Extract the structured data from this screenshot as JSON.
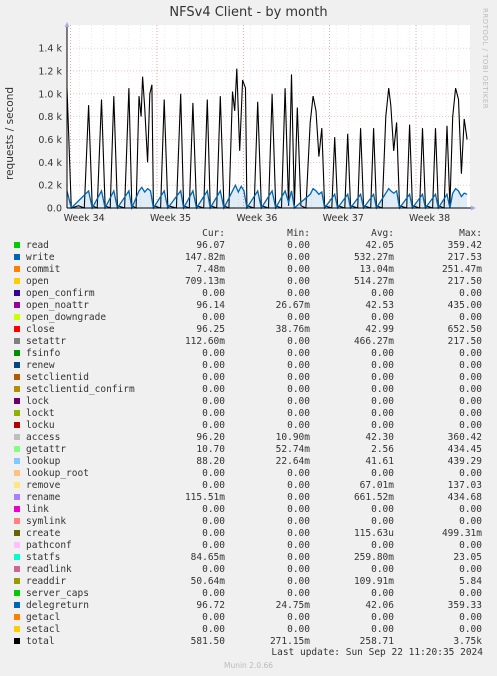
{
  "title": "NFSv4 Client - by month",
  "side_text": "RRDTOOL / TOBI OETIKER",
  "ylabel": "requests / second",
  "columns": {
    "cur": "Cur:",
    "min": "Min:",
    "avg": "Avg:",
    "max": "Max:"
  },
  "legend": [
    {
      "name": "read",
      "color": "#00cc00",
      "cur": "96.07",
      "min": "0.00",
      "avg": "42.05",
      "max": "359.42"
    },
    {
      "name": "write",
      "color": "#0066b3",
      "cur": "147.82m",
      "min": "0.00",
      "avg": "532.27m",
      "max": "217.53"
    },
    {
      "name": "commit",
      "color": "#ff8000",
      "cur": "7.48m",
      "min": "0.00",
      "avg": "13.04m",
      "max": "251.47m"
    },
    {
      "name": "open",
      "color": "#ffcc00",
      "cur": "709.13m",
      "min": "0.00",
      "avg": "514.27m",
      "max": "217.50"
    },
    {
      "name": "open_confirm",
      "color": "#330099",
      "cur": "0.00",
      "min": "0.00",
      "avg": "0.00",
      "max": "0.00"
    },
    {
      "name": "open_noattr",
      "color": "#990099",
      "cur": "96.14",
      "min": "26.67m",
      "avg": "42.53",
      "max": "435.00"
    },
    {
      "name": "open_downgrade",
      "color": "#ccff00",
      "cur": "0.00",
      "min": "0.00",
      "avg": "0.00",
      "max": "0.00"
    },
    {
      "name": "close",
      "color": "#ff0000",
      "cur": "96.25",
      "min": "38.76m",
      "avg": "42.99",
      "max": "652.50"
    },
    {
      "name": "setattr",
      "color": "#808080",
      "cur": "112.60m",
      "min": "0.00",
      "avg": "466.27m",
      "max": "217.50"
    },
    {
      "name": "fsinfo",
      "color": "#008f00",
      "cur": "0.00",
      "min": "0.00",
      "avg": "0.00",
      "max": "0.00"
    },
    {
      "name": "renew",
      "color": "#00487d",
      "cur": "0.00",
      "min": "0.00",
      "avg": "0.00",
      "max": "0.00"
    },
    {
      "name": "setclientid",
      "color": "#b35a00",
      "cur": "0.00",
      "min": "0.00",
      "avg": "0.00",
      "max": "0.00"
    },
    {
      "name": "setclientid_confirm",
      "color": "#b38f00",
      "cur": "0.00",
      "min": "0.00",
      "avg": "0.00",
      "max": "0.00"
    },
    {
      "name": "lock",
      "color": "#6b006b",
      "cur": "0.00",
      "min": "0.00",
      "avg": "0.00",
      "max": "0.00"
    },
    {
      "name": "lockt",
      "color": "#8fb300",
      "cur": "0.00",
      "min": "0.00",
      "avg": "0.00",
      "max": "0.00"
    },
    {
      "name": "locku",
      "color": "#b30000",
      "cur": "0.00",
      "min": "0.00",
      "avg": "0.00",
      "max": "0.00"
    },
    {
      "name": "access",
      "color": "#bebebe",
      "cur": "96.20",
      "min": "10.90m",
      "avg": "42.30",
      "max": "360.42"
    },
    {
      "name": "getattr",
      "color": "#80ff80",
      "cur": "10.70",
      "min": "52.74m",
      "avg": "2.56",
      "max": "434.45"
    },
    {
      "name": "lookup",
      "color": "#80c9ff",
      "cur": "88.20",
      "min": "22.64m",
      "avg": "41.61",
      "max": "439.29"
    },
    {
      "name": "lookup_root",
      "color": "#ffc080",
      "cur": "0.00",
      "min": "0.00",
      "avg": "0.00",
      "max": "0.00"
    },
    {
      "name": "remove",
      "color": "#ffe680",
      "cur": "0.00",
      "min": "0.00",
      "avg": "67.01m",
      "max": "137.03"
    },
    {
      "name": "rename",
      "color": "#aa80ff",
      "cur": "115.51m",
      "min": "0.00",
      "avg": "661.52m",
      "max": "434.68"
    },
    {
      "name": "link",
      "color": "#ee00cc",
      "cur": "0.00",
      "min": "0.00",
      "avg": "0.00",
      "max": "0.00"
    },
    {
      "name": "symlink",
      "color": "#ff8080",
      "cur": "0.00",
      "min": "0.00",
      "avg": "0.00",
      "max": "0.00"
    },
    {
      "name": "create",
      "color": "#666600",
      "cur": "0.00",
      "min": "0.00",
      "avg": "115.63u",
      "max": "499.31m"
    },
    {
      "name": "pathconf",
      "color": "#ffbfff",
      "cur": "0.00",
      "min": "0.00",
      "avg": "0.00",
      "max": "0.00"
    },
    {
      "name": "statfs",
      "color": "#00ffcc",
      "cur": "84.65m",
      "min": "0.00",
      "avg": "259.80m",
      "max": "23.05"
    },
    {
      "name": "readlink",
      "color": "#cc6699",
      "cur": "0.00",
      "min": "0.00",
      "avg": "0.00",
      "max": "0.00"
    },
    {
      "name": "readdir",
      "color": "#999900",
      "cur": "50.64m",
      "min": "0.00",
      "avg": "109.91m",
      "max": "5.84"
    },
    {
      "name": "server_caps",
      "color": "#00cc00",
      "cur": "0.00",
      "min": "0.00",
      "avg": "0.00",
      "max": "0.00"
    },
    {
      "name": "delegreturn",
      "color": "#0066b3",
      "cur": "96.72",
      "min": "24.75m",
      "avg": "42.06",
      "max": "359.33"
    },
    {
      "name": "getacl",
      "color": "#ff8000",
      "cur": "0.00",
      "min": "0.00",
      "avg": "0.00",
      "max": "0.00"
    },
    {
      "name": "setacl",
      "color": "#ffcc00",
      "cur": "0.00",
      "min": "0.00",
      "avg": "0.00",
      "max": "0.00"
    },
    {
      "name": "total",
      "color": "#000000",
      "cur": "581.50",
      "min": "271.15m",
      "avg": "258.71",
      "max": "3.75k"
    }
  ],
  "footer": {
    "last_update": "Last update: Sun Sep 22 11:20:35 2024",
    "version": "Munin 2.0.66"
  },
  "chart_data": {
    "type": "line",
    "title": "NFSv4 Client - by month",
    "ylabel": "requests / second",
    "xlabel": "",
    "ylim": [
      0,
      1.55
    ],
    "yticks": [
      "0.0",
      "0.2 k",
      "0.4 k",
      "0.6 k",
      "0.8 k",
      "1.0 k",
      "1.2 k",
      "1.4 k"
    ],
    "xticks": [
      "Week 34",
      "Week 35",
      "Week 36",
      "Week 37",
      "Week 38"
    ],
    "grid": true,
    "series": [
      {
        "name": "total",
        "color": "#000000",
        "points": [
          [
            0,
            1.05
          ],
          [
            0.6,
            0.0
          ],
          [
            1.6,
            0.02
          ],
          [
            2.4,
            0.0
          ],
          [
            3.0,
            0.9
          ],
          [
            3.5,
            0.02
          ],
          [
            4.2,
            0.0
          ],
          [
            4.8,
            0.95
          ],
          [
            5.3,
            0.02
          ],
          [
            6.0,
            0.0
          ],
          [
            6.5,
            0.98
          ],
          [
            7.0,
            0.02
          ],
          [
            8.0,
            0.0
          ],
          [
            8.6,
            1.05
          ],
          [
            9.0,
            0.02
          ],
          [
            9.6,
            0.0
          ],
          [
            10.0,
            0.98
          ],
          [
            10.3,
            0.8
          ],
          [
            10.5,
            1.15
          ],
          [
            10.8,
            0.88
          ],
          [
            11.2,
            0.4
          ],
          [
            11.5,
            1.0
          ],
          [
            11.8,
            1.08
          ],
          [
            12.0,
            0.02
          ],
          [
            13.0,
            0.0
          ],
          [
            13.5,
            0.95
          ],
          [
            14.0,
            0.02
          ],
          [
            15.2,
            0.0
          ],
          [
            15.8,
            1.0
          ],
          [
            16.2,
            0.02
          ],
          [
            17.0,
            0.0
          ],
          [
            17.5,
            0.92
          ],
          [
            18.0,
            0.02
          ],
          [
            19.0,
            0.0
          ],
          [
            19.5,
            0.95
          ],
          [
            19.9,
            0.02
          ],
          [
            20.8,
            0.0
          ],
          [
            21.3,
            0.98
          ],
          [
            21.8,
            0.02
          ],
          [
            22.5,
            0.0
          ],
          [
            23.0,
            1.02
          ],
          [
            23.3,
            0.85
          ],
          [
            23.6,
            1.22
          ],
          [
            24.0,
            0.5
          ],
          [
            24.4,
            1.12
          ],
          [
            24.8,
            1.05
          ],
          [
            25.0,
            0.02
          ],
          [
            26.0,
            0.0
          ],
          [
            26.5,
            0.93
          ],
          [
            27.0,
            0.02
          ],
          [
            28.0,
            0.0
          ],
          [
            28.5,
            1.0
          ],
          [
            29.0,
            0.02
          ],
          [
            29.8,
            0.0
          ],
          [
            30.3,
            1.05
          ],
          [
            30.8,
            0.02
          ],
          [
            31.2,
            1.17
          ],
          [
            31.6,
            0.02
          ],
          [
            32.0,
            0.88
          ],
          [
            32.5,
            0.02
          ],
          [
            33.2,
            0.0
          ],
          [
            33.8,
            0.75
          ],
          [
            34.2,
            0.98
          ],
          [
            34.6,
            0.85
          ],
          [
            35.0,
            0.45
          ],
          [
            35.4,
            0.7
          ],
          [
            35.8,
            0.02
          ],
          [
            36.8,
            0.0
          ],
          [
            37.2,
            0.62
          ],
          [
            37.6,
            0.02
          ],
          [
            38.6,
            0.0
          ],
          [
            39.0,
            0.65
          ],
          [
            39.4,
            0.02
          ],
          [
            40.4,
            0.0
          ],
          [
            40.8,
            0.7
          ],
          [
            41.2,
            0.02
          ],
          [
            42.2,
            0.0
          ],
          [
            42.6,
            0.7
          ],
          [
            43.0,
            0.02
          ],
          [
            43.8,
            0.0
          ],
          [
            44.3,
            0.8
          ],
          [
            44.7,
            1.05
          ],
          [
            45.0,
            0.9
          ],
          [
            45.4,
            0.5
          ],
          [
            45.8,
            0.75
          ],
          [
            46.2,
            0.02
          ],
          [
            47.2,
            0.0
          ],
          [
            47.6,
            0.73
          ],
          [
            48.0,
            0.02
          ],
          [
            49.0,
            0.0
          ],
          [
            49.4,
            0.7
          ],
          [
            49.8,
            0.02
          ],
          [
            50.8,
            0.0
          ],
          [
            51.2,
            0.7
          ],
          [
            51.6,
            0.02
          ],
          [
            52.4,
            0.0
          ],
          [
            52.8,
            0.72
          ],
          [
            53.2,
            0.02
          ],
          [
            53.6,
            0.8
          ],
          [
            54.0,
            1.05
          ],
          [
            54.4,
            0.95
          ],
          [
            54.8,
            0.3
          ],
          [
            55.2,
            0.78
          ],
          [
            55.6,
            0.6
          ]
        ]
      },
      {
        "name": "write",
        "color": "#0066b3",
        "points": [
          [
            0,
            0.15
          ],
          [
            0.6,
            0.0
          ],
          [
            3.0,
            0.15
          ],
          [
            3.5,
            0.0
          ],
          [
            4.8,
            0.15
          ],
          [
            5.3,
            0.0
          ],
          [
            6.5,
            0.15
          ],
          [
            7.0,
            0.0
          ],
          [
            8.6,
            0.15
          ],
          [
            9.0,
            0.0
          ],
          [
            10.0,
            0.15
          ],
          [
            10.4,
            0.18
          ],
          [
            10.8,
            0.14
          ],
          [
            11.2,
            0.17
          ],
          [
            11.6,
            0.15
          ],
          [
            12.0,
            0.0
          ],
          [
            13.5,
            0.15
          ],
          [
            14.0,
            0.0
          ],
          [
            15.8,
            0.15
          ],
          [
            16.2,
            0.0
          ],
          [
            17.5,
            0.15
          ],
          [
            18.0,
            0.0
          ],
          [
            19.5,
            0.15
          ],
          [
            19.9,
            0.0
          ],
          [
            21.3,
            0.15
          ],
          [
            21.8,
            0.0
          ],
          [
            23.0,
            0.15
          ],
          [
            23.4,
            0.2
          ],
          [
            23.8,
            0.14
          ],
          [
            24.2,
            0.19
          ],
          [
            24.6,
            0.15
          ],
          [
            25.0,
            0.0
          ],
          [
            26.5,
            0.15
          ],
          [
            27.0,
            0.0
          ],
          [
            28.5,
            0.15
          ],
          [
            29.0,
            0.0
          ],
          [
            30.3,
            0.15
          ],
          [
            30.8,
            0.05
          ],
          [
            31.2,
            0.15
          ],
          [
            31.6,
            0.0
          ],
          [
            33.8,
            0.12
          ],
          [
            34.2,
            0.17
          ],
          [
            34.6,
            0.15
          ],
          [
            35.0,
            0.12
          ],
          [
            35.4,
            0.14
          ],
          [
            35.8,
            0.0
          ],
          [
            37.2,
            0.12
          ],
          [
            37.6,
            0.0
          ],
          [
            39.0,
            0.12
          ],
          [
            39.4,
            0.0
          ],
          [
            40.8,
            0.12
          ],
          [
            41.2,
            0.0
          ],
          [
            42.6,
            0.12
          ],
          [
            43.0,
            0.0
          ],
          [
            44.3,
            0.13
          ],
          [
            44.7,
            0.17
          ],
          [
            45.0,
            0.15
          ],
          [
            45.4,
            0.13
          ],
          [
            45.8,
            0.15
          ],
          [
            46.2,
            0.0
          ],
          [
            47.6,
            0.12
          ],
          [
            48.0,
            0.0
          ],
          [
            49.4,
            0.12
          ],
          [
            49.8,
            0.0
          ],
          [
            51.2,
            0.12
          ],
          [
            51.6,
            0.0
          ],
          [
            52.8,
            0.12
          ],
          [
            53.2,
            0.0
          ],
          [
            53.6,
            0.13
          ],
          [
            54.0,
            0.17
          ],
          [
            54.4,
            0.15
          ],
          [
            54.8,
            0.1
          ],
          [
            55.2,
            0.13
          ],
          [
            55.6,
            0.12
          ]
        ]
      }
    ]
  }
}
